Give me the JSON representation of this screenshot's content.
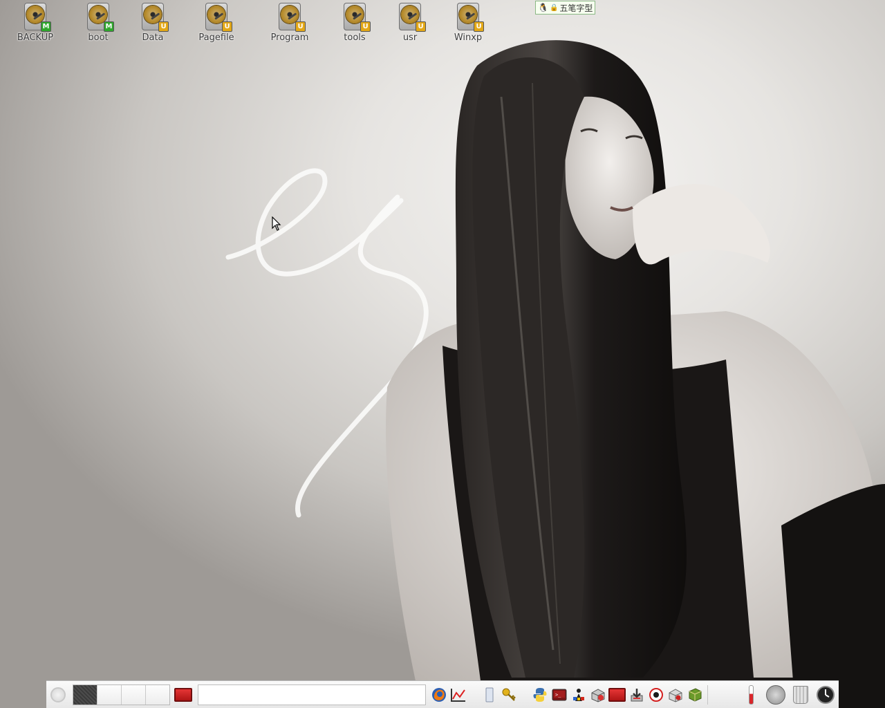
{
  "desktop": {
    "icons": [
      {
        "label": "BACKUP",
        "badge": "M"
      },
      {
        "label": "boot",
        "badge": "M"
      },
      {
        "label": "Data",
        "badge": "U"
      },
      {
        "label": "Pagefile",
        "badge": "U"
      },
      {
        "label": "Program",
        "badge": "U"
      },
      {
        "label": "tools",
        "badge": "U"
      },
      {
        "label": "usr",
        "badge": "U"
      },
      {
        "label": "Winxp",
        "badge": "U"
      }
    ]
  },
  "ime_indicator": {
    "text": "五笔字型",
    "icon": "tux-icon"
  },
  "panel": {
    "workspaces": 4,
    "active_workspace": 1,
    "launchers": [
      "firefox-icon",
      "chart-app-icon",
      "file-icon",
      "keys-icon",
      "python-icon",
      "terminal-icon",
      "system-tool-icon",
      "package-icon",
      "red-window-icon",
      "download-icon",
      "qq-icon",
      "box-icon",
      "book-icon"
    ],
    "tray": [
      "thermometer-icon",
      "cpu-gauge-icon",
      "trash-icon",
      "clock-icon"
    ]
  },
  "colors": {
    "badge_m": "#2fa82c",
    "badge_u": "#e3a817",
    "panel_bg": "#f0f0f0"
  }
}
